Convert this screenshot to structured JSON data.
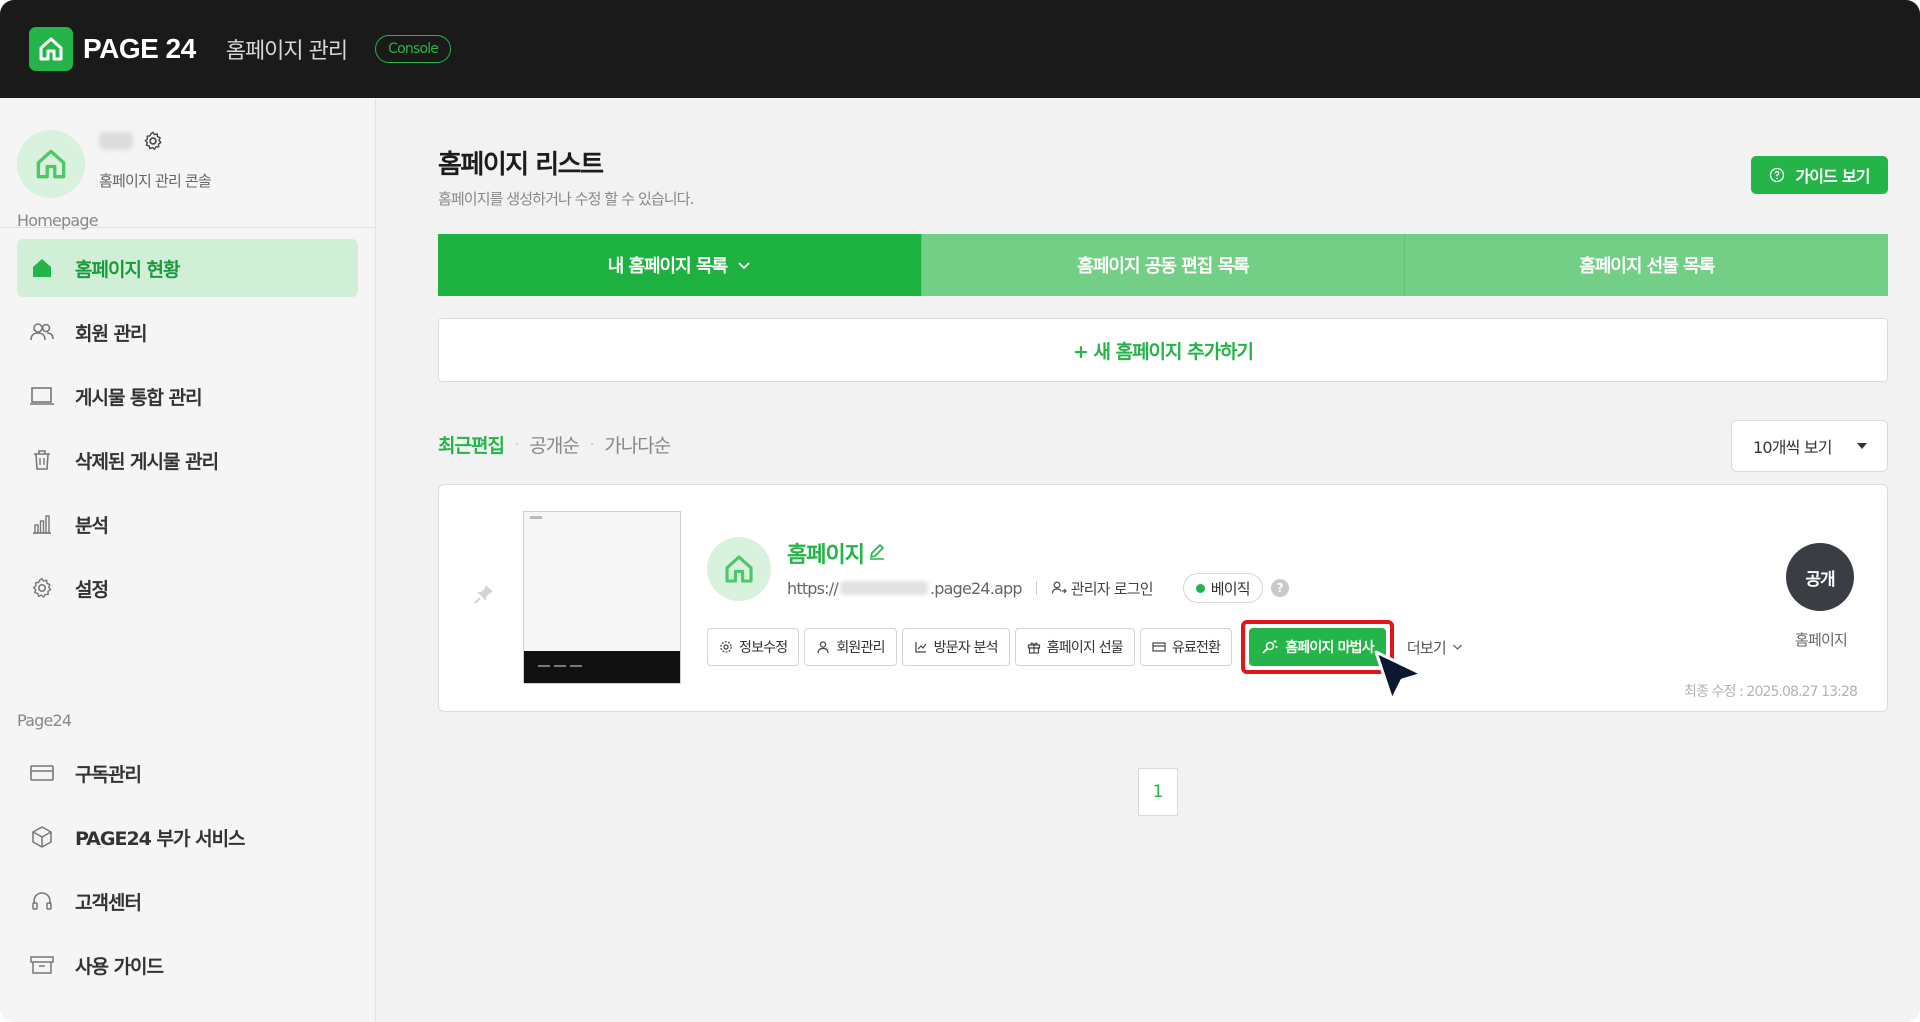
{
  "header": {
    "logo_text": "PAGE 24",
    "title": "홈페이지 관리",
    "console_badge": "Console"
  },
  "sidebar": {
    "profile_sub": "홈페이지 관리 콘솔",
    "section_homepage": "Homepage",
    "homepage_items": [
      {
        "label": "홈페이지 현황",
        "icon": "home-icon",
        "active": true
      },
      {
        "label": "회원 관리",
        "icon": "users-icon"
      },
      {
        "label": "게시물 통합 관리",
        "icon": "monitor-icon"
      },
      {
        "label": "삭제된 게시물 관리",
        "icon": "trash-icon"
      },
      {
        "label": "분석",
        "icon": "bar-chart-icon"
      },
      {
        "label": "설정",
        "icon": "gear-icon"
      }
    ],
    "section_page24": "Page24",
    "page24_items": [
      {
        "label": "구독관리",
        "icon": "card-icon"
      },
      {
        "label": "PAGE24 부가 서비스",
        "icon": "box-icon"
      },
      {
        "label": "고객센터",
        "icon": "headset-icon"
      },
      {
        "label": "사용 가이드",
        "icon": "archive-icon"
      }
    ]
  },
  "main": {
    "title": "홈페이지 리스트",
    "description": "홈페이지를 생성하거나 수정 할 수 있습니다.",
    "guide_button": "가이드 보기",
    "tabs": [
      {
        "label": "내 홈페이지 목록",
        "active": true
      },
      {
        "label": "홈페이지 공동 편집 목록"
      },
      {
        "label": "홈페이지 선물 목록"
      }
    ],
    "add_label": "+ 새 홈페이지 추가하기",
    "sort": [
      "최근편집",
      "공개순",
      "가나다순"
    ],
    "per_page": "10개씩 보기",
    "pagination_current": "1"
  },
  "site": {
    "name": "홈페이지",
    "url_prefix": "https://",
    "url_suffix": ".page24.app",
    "admin_login": "관리자 로그인",
    "plan": "베이직",
    "help": "?",
    "actions": [
      "정보수정",
      "회원관리",
      "방문자 분석",
      "홈페이지 선물",
      "유료전환",
      "홈페이지 마법사"
    ],
    "more": "더보기",
    "status": "공개",
    "status_label": "홈페이지",
    "updated": "최종 수정 : 2025.08.27 13:28"
  },
  "colors": {
    "brand_green": "#25b449",
    "tab_light": "#73cf86",
    "active_bg": "#d1efd6",
    "highlight_red": "#e0161b",
    "topbar": "#1a1a1a"
  }
}
